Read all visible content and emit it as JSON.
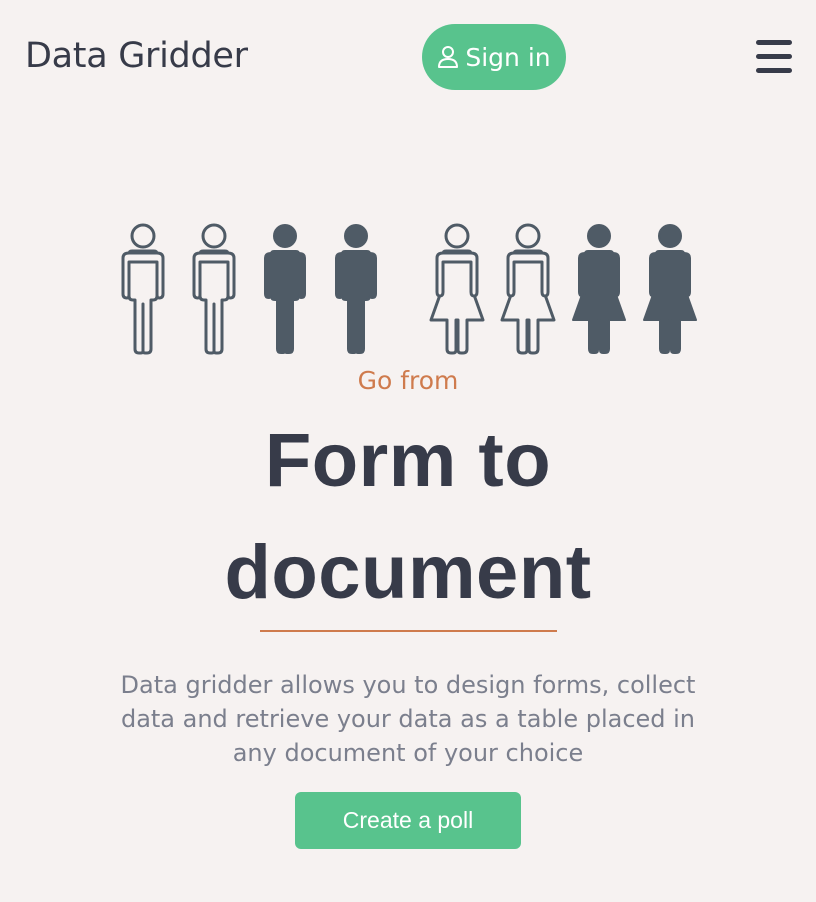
{
  "header": {
    "brand": "Data Gridder",
    "signin_label": "Sign in",
    "signin_icon": "user-icon",
    "menu_icon": "hamburger-icon"
  },
  "hero": {
    "illustration_icons": [
      "male-outline-icon",
      "male-outline-icon",
      "male-filled-icon",
      "male-filled-icon",
      "female-outline-icon",
      "female-outline-icon",
      "female-filled-icon",
      "female-filled-icon"
    ],
    "eyebrow": "Go from",
    "headline_line1": "Form to",
    "headline_line2": "document",
    "description": "Data gridder allows you to design forms, collect data and retrieve your data as a table placed in any document of your choice",
    "cta_label": "Create a poll"
  },
  "colors": {
    "background": "#f6f2f1",
    "accent_green": "#58c38d",
    "accent_orange": "#cf7b4d",
    "text_dark": "#373b49",
    "text_muted": "#7b7f8d",
    "figure_fill": "#4f5b66"
  }
}
